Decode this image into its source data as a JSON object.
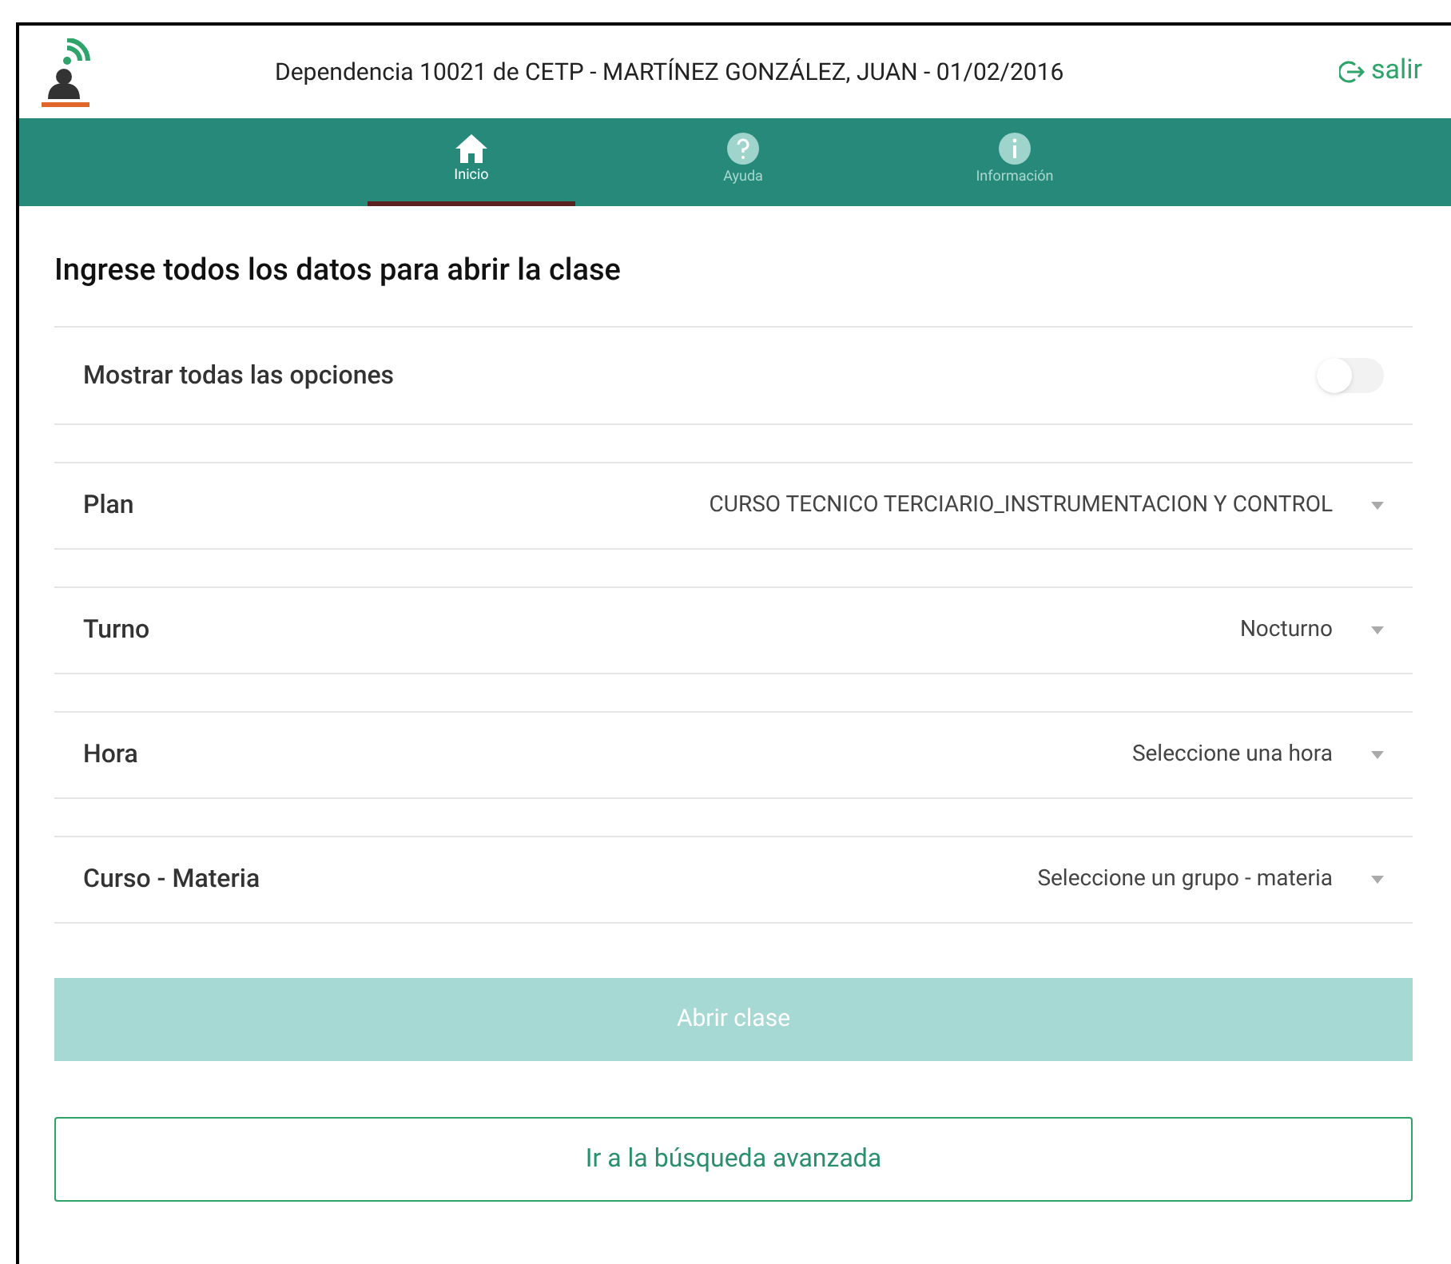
{
  "header": {
    "title": "Dependencia 10021 de CETP -  MARTÍNEZ GONZÁLEZ, JUAN  - 01/02/2016",
    "logout": "salir"
  },
  "tabs": [
    {
      "label": "Inicio",
      "kind": "home",
      "selected": true
    },
    {
      "label": "Ayuda",
      "kind": "help",
      "selected": false
    },
    {
      "label": "Información",
      "kind": "info",
      "selected": false
    }
  ],
  "heading": "Ingrese todos los datos para abrir la clase",
  "toggle": {
    "label": "Mostrar todas las opciones",
    "on": false
  },
  "selects": [
    {
      "label": "Plan",
      "value": "CURSO TECNICO TERCIARIO_INSTRUMENTACION Y CONTROL"
    },
    {
      "label": "Turno",
      "value": "Nocturno"
    },
    {
      "label": "Hora",
      "value": "Seleccione una hora"
    },
    {
      "label": "Curso - Materia",
      "value": "Seleccione un grupo - materia"
    }
  ],
  "primary_button": {
    "label": "Abrir clase",
    "disabled": true
  },
  "secondary_button": {
    "label": "Ir a la búsqueda avanzada"
  }
}
